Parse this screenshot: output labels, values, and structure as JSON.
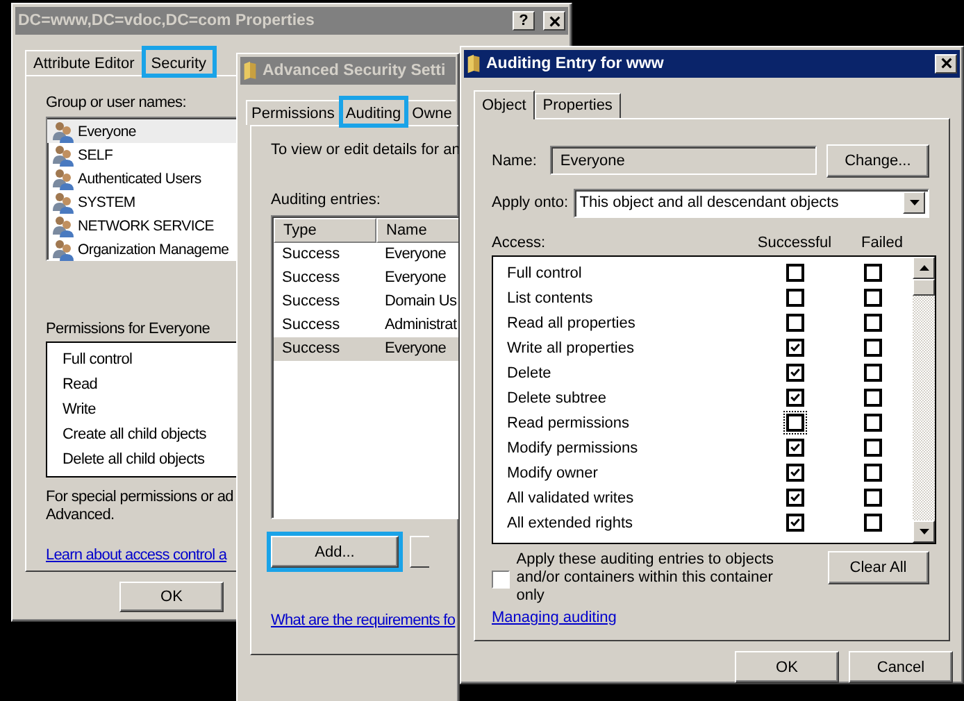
{
  "windows": [
    {
      "kind": "properties",
      "title": "DC=www,DC=vdoc,DC=com Properties",
      "active": false,
      "help_button": "?",
      "tabs": [
        {
          "label": "Attribute Editor",
          "selected": false,
          "highlighted": false
        },
        {
          "label": "Security",
          "selected": true,
          "highlighted": true
        }
      ],
      "group_label": "Group or user names:",
      "users": [
        {
          "name": "Everyone",
          "selected": true
        },
        {
          "name": "SELF",
          "selected": false
        },
        {
          "name": "Authenticated Users",
          "selected": false
        },
        {
          "name": "SYSTEM",
          "selected": false
        },
        {
          "name": "NETWORK SERVICE",
          "selected": false
        },
        {
          "name": "Organization Manageme",
          "selected": false
        }
      ],
      "permissions_label": "Permissions for Everyone",
      "permissions": [
        "Full control",
        "Read",
        "Write",
        "Create all child objects",
        "Delete all child objects"
      ],
      "note": [
        "For special permissions or ad",
        "Advanced."
      ],
      "link": "Learn about access control a",
      "buttons": [
        {
          "label": "OK",
          "highlighted": false
        }
      ]
    },
    {
      "kind": "advanced",
      "title": "Advanced Security Setti",
      "active": false,
      "tabs": [
        {
          "label": "Permissions",
          "selected": false,
          "highlighted": false
        },
        {
          "label": "Auditing",
          "selected": true,
          "highlighted": true
        },
        {
          "label": "Owne",
          "selected": false,
          "highlighted": false
        }
      ],
      "description": "To view or edit details for an",
      "entries_label": "Auditing entries:",
      "table": {
        "columns": [
          "Type",
          "Name"
        ],
        "rows": [
          {
            "type": "Success",
            "name": "Everyone",
            "selected": false
          },
          {
            "type": "Success",
            "name": "Everyone",
            "selected": false
          },
          {
            "type": "Success",
            "name": "Domain Us",
            "selected": false
          },
          {
            "type": "Success",
            "name": "Administrat",
            "selected": false
          },
          {
            "type": "Success",
            "name": "Everyone",
            "selected": true
          }
        ]
      },
      "buttons": [
        {
          "label": "Add...",
          "highlighted": true
        }
      ],
      "link": "What are the requirements fo"
    },
    {
      "kind": "entry",
      "title": "Auditing Entry for www",
      "active": true,
      "tabs": [
        {
          "label": "Object",
          "selected": true,
          "highlighted": false
        },
        {
          "label": "Properties",
          "selected": false,
          "highlighted": false
        }
      ],
      "name_label": "Name:",
      "name_value": "Everyone",
      "change_button": "Change...",
      "apply_label": "Apply onto:",
      "apply_value": "This object and all descendant objects",
      "access_label": "Access:",
      "columns": [
        "Successful",
        "Failed"
      ],
      "access": [
        {
          "name": "Full control",
          "successful": false,
          "failed": false
        },
        {
          "name": "List contents",
          "successful": false,
          "failed": false
        },
        {
          "name": "Read all properties",
          "successful": false,
          "failed": false
        },
        {
          "name": "Write all properties",
          "successful": true,
          "failed": false
        },
        {
          "name": "Delete",
          "successful": true,
          "failed": false
        },
        {
          "name": "Delete subtree",
          "successful": true,
          "failed": false
        },
        {
          "name": "Read permissions",
          "successful": false,
          "failed": false,
          "focused": true
        },
        {
          "name": "Modify permissions",
          "successful": true,
          "failed": false
        },
        {
          "name": "Modify owner",
          "successful": true,
          "failed": false
        },
        {
          "name": "All validated writes",
          "successful": true,
          "failed": false
        },
        {
          "name": "All extended rights",
          "successful": true,
          "failed": false
        }
      ],
      "apply_only": {
        "label": "Apply these auditing entries to objects and/or containers within this container only",
        "checked": false
      },
      "clear_button": "Clear All",
      "link": "Managing auditing",
      "buttons": [
        {
          "label": "OK",
          "highlighted": false
        },
        {
          "label": "Cancel",
          "highlighted": false
        }
      ]
    }
  ]
}
